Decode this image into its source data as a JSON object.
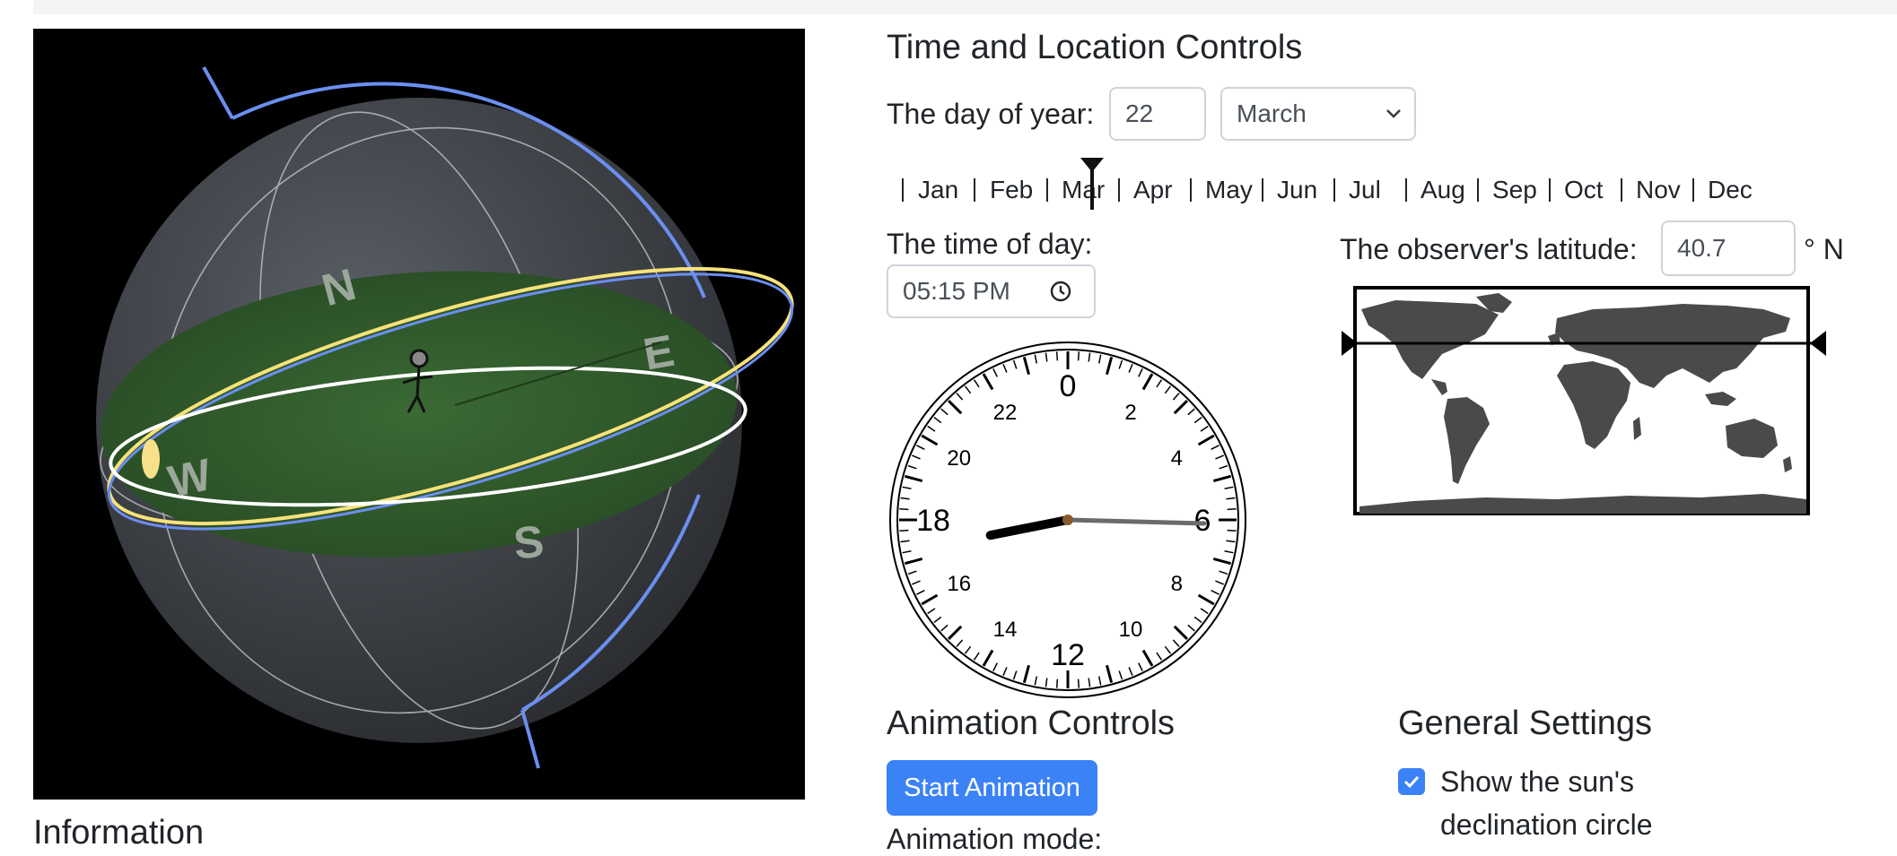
{
  "scene": {
    "compass": {
      "north": "N",
      "east": "E",
      "south": "S",
      "west": "W"
    }
  },
  "info_heading": "Information",
  "time_location": {
    "heading": "Time and Location Controls",
    "day_label": "The day of year:",
    "day_value": "22",
    "month_value": "March",
    "months": [
      "Jan",
      "Feb",
      "Mar",
      "Apr",
      "May",
      "Jun",
      "Jul",
      "Aug",
      "Sep",
      "Oct",
      "Nov",
      "Dec"
    ],
    "time_label": "The time of day:",
    "time_value": "05:15 PM",
    "latitude_label": "The observer's latitude:",
    "latitude_value": "40.7",
    "latitude_unit": "° N"
  },
  "clock": {
    "labels_major": [
      "0",
      "6",
      "12",
      "18"
    ],
    "labels_minor": [
      "2",
      "4",
      "8",
      "10",
      "14",
      "16",
      "20",
      "22"
    ]
  },
  "animation": {
    "heading": "Animation Controls",
    "start_button": "Start Animation",
    "mode_label": "Animation mode:"
  },
  "general": {
    "heading": "General Settings",
    "checkbox_line1": "Show the sun's",
    "checkbox_line2": "declination circle",
    "checkbox_checked": true
  },
  "colors": {
    "accent": "#3b82f6",
    "ground": "#2f5a2a",
    "celestial_equator": "#6b8ff0",
    "sun_path": "#f6e27a",
    "horizon": "#ffffff"
  }
}
